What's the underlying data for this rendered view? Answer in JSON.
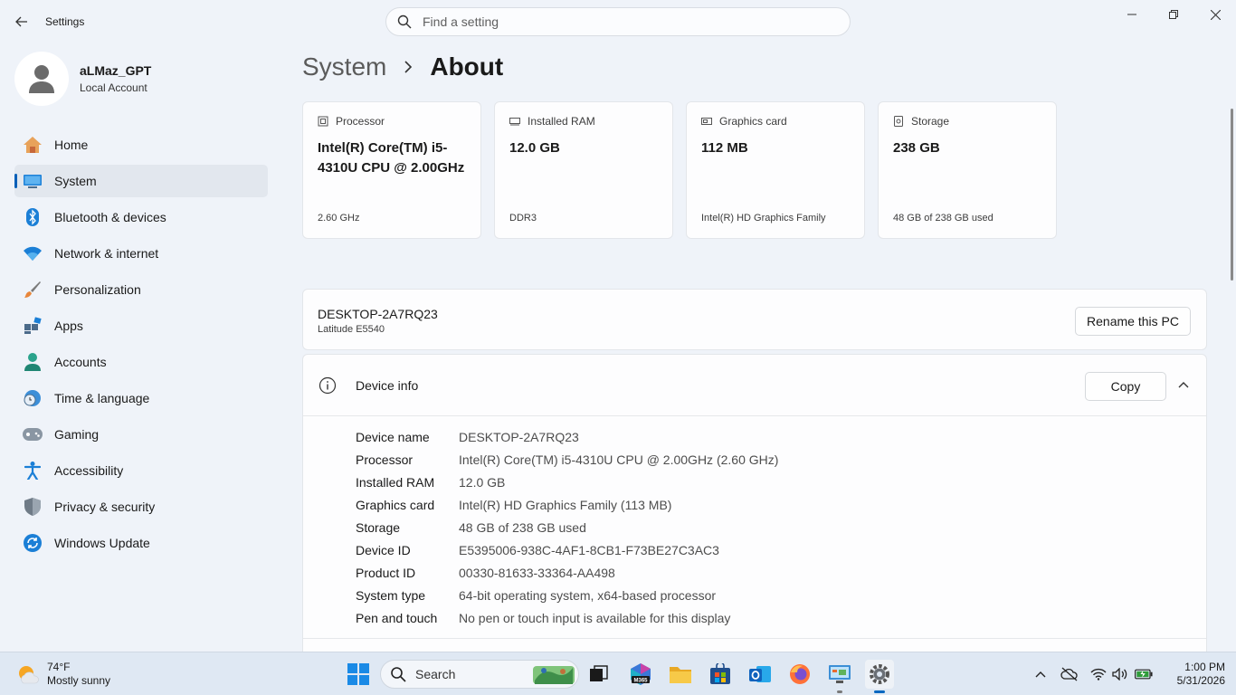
{
  "window": {
    "title": "Settings",
    "search_placeholder": "Find a setting"
  },
  "profile": {
    "name": "aLMaz_GPT",
    "account_type": "Local Account"
  },
  "nav": [
    {
      "label": "Home",
      "icon": "home-icon"
    },
    {
      "label": "System",
      "icon": "system-icon",
      "active": true
    },
    {
      "label": "Bluetooth & devices",
      "icon": "bluetooth-icon"
    },
    {
      "label": "Network & internet",
      "icon": "wifi-icon"
    },
    {
      "label": "Personalization",
      "icon": "brush-icon"
    },
    {
      "label": "Apps",
      "icon": "apps-icon"
    },
    {
      "label": "Accounts",
      "icon": "accounts-icon"
    },
    {
      "label": "Time & language",
      "icon": "clock-globe-icon"
    },
    {
      "label": "Gaming",
      "icon": "gamepad-icon"
    },
    {
      "label": "Accessibility",
      "icon": "accessibility-icon"
    },
    {
      "label": "Privacy & security",
      "icon": "shield-icon"
    },
    {
      "label": "Windows Update",
      "icon": "update-icon"
    }
  ],
  "breadcrumb": {
    "parent": "System",
    "current": "About"
  },
  "specs": [
    {
      "label": "Processor",
      "value": "Intel(R) Core(TM) i5-4310U CPU @ 2.00GHz",
      "sub": "2.60 GHz",
      "icon": "processor-icon"
    },
    {
      "label": "Installed RAM",
      "value": "12.0 GB",
      "sub": "DDR3",
      "icon": "ram-icon"
    },
    {
      "label": "Graphics card",
      "value": "112 MB",
      "sub": "Intel(R) HD Graphics Family",
      "icon": "graphics-card-icon"
    },
    {
      "label": "Storage",
      "value": "238 GB",
      "sub": "48 GB of 238 GB used",
      "icon": "storage-icon"
    }
  ],
  "pc": {
    "name": "DESKTOP-2A7RQ23",
    "model": "Latitude E5540",
    "rename_label": "Rename this PC"
  },
  "device_info": {
    "title": "Device info",
    "copy_label": "Copy",
    "rows": [
      {
        "label": "Device name",
        "value": "DESKTOP-2A7RQ23"
      },
      {
        "label": "Processor",
        "value": "Intel(R) Core(TM) i5-4310U CPU @ 2.00GHz (2.60 GHz)"
      },
      {
        "label": "Installed RAM",
        "value": "12.0 GB"
      },
      {
        "label": "Graphics card",
        "value": "Intel(R) HD Graphics Family (113 MB)"
      },
      {
        "label": "Storage",
        "value": "48 GB of 238 GB used"
      },
      {
        "label": "Device ID",
        "value": "E5395006-938C-4AF1-8CB1-F73BE27C3AC3"
      },
      {
        "label": "Product ID",
        "value": "00330-81633-33364-AA498"
      },
      {
        "label": "System type",
        "value": "64-bit operating system, x64-based processor"
      },
      {
        "label": "Pen and touch",
        "value": "No pen or touch input is available for this display"
      }
    ]
  },
  "taskbar": {
    "weather_temp": "74°F",
    "weather_desc": "Mostly sunny",
    "search_label": "Search",
    "time": "1:00 PM",
    "date": "5/31/2026",
    "m365_label": "M365"
  },
  "colors": {
    "accent": "#005fb8",
    "background": "#eff3f9",
    "card": "#fdfdfe",
    "taskbar": "#dfe8f3"
  }
}
